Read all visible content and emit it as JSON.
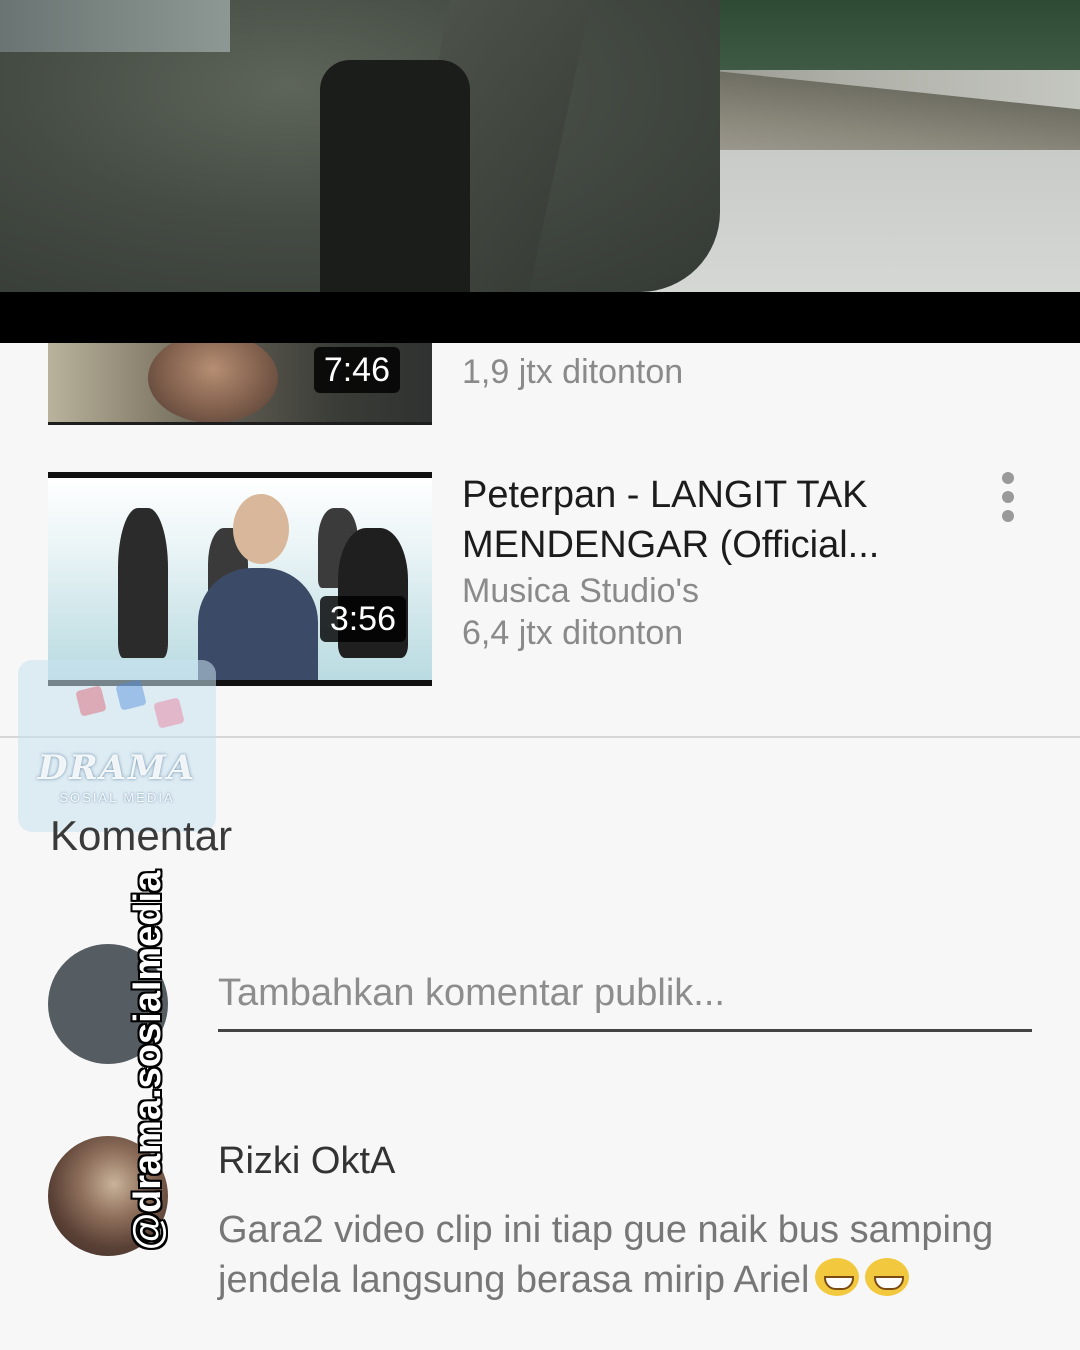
{
  "list": {
    "item1": {
      "duration": "7:46",
      "views": "1,9 jtx ditonton"
    },
    "item2": {
      "title": "Peterpan - LANGIT TAK MENDENGAR (Official...",
      "channel": "Musica Studio's",
      "duration": "3:56",
      "views": "6,4 jtx ditonton"
    }
  },
  "comments": {
    "section_title": "Komentar",
    "input_placeholder": "Tambahkan komentar publik...",
    "items": [
      {
        "author": "Rizki OktA",
        "text": "Gara2 video clip ini tiap gue naik bus samping jendela langsung berasa mirip Ariel",
        "emoji": [
          "grinning-squinting-face",
          "grinning-squinting-face"
        ]
      }
    ]
  },
  "watermark": {
    "logo_text": "DRAMA",
    "logo_sub": "SOSIAL MEDIA",
    "handle": "@drama.sosialmedia"
  },
  "colors": {
    "background": "#f7f7f7",
    "player_bar": "#000000",
    "avatar_placeholder": "#555d63"
  }
}
